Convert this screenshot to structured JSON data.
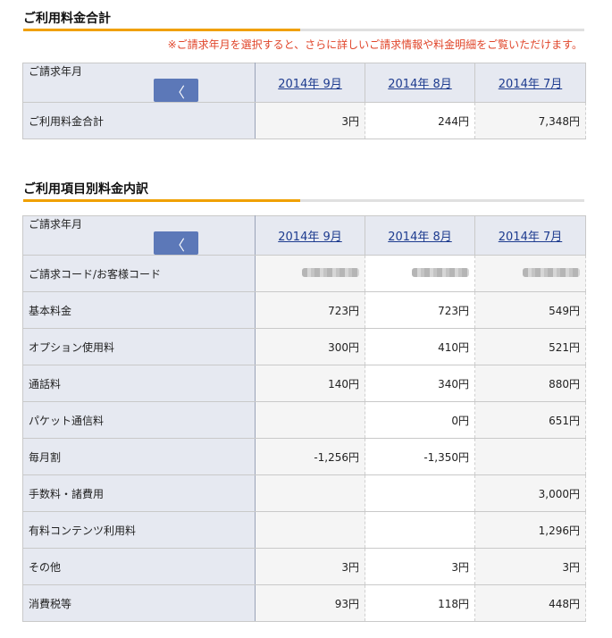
{
  "summary": {
    "title": "ご利用料金合計",
    "note": "※ご請求年月を選択すると、さらに詳しいご請求情報や料金明細をご覧いただけます。",
    "header_label": "ご請求年月",
    "prev_icon": "chevron-left-icon",
    "months": [
      "2014年 9月",
      "2014年 8月",
      "2014年 7月"
    ],
    "total_row": {
      "label": "ご利用料金合計",
      "values": [
        "3円",
        "244円",
        "7,348円"
      ]
    }
  },
  "breakdown": {
    "title": "ご利用項目別料金内訳",
    "header_label": "ご請求年月",
    "months": [
      "2014年 9月",
      "2014年 8月",
      "2014年 7月"
    ],
    "code_row_label": "ご請求コード/お客様コード",
    "rows": [
      {
        "label": "基本料金",
        "values": [
          "723円",
          "723円",
          "549円"
        ]
      },
      {
        "label": "オプション使用料",
        "values": [
          "300円",
          "410円",
          "521円"
        ]
      },
      {
        "label": "通話料",
        "values": [
          "140円",
          "340円",
          "880円"
        ]
      },
      {
        "label": "パケット通信料",
        "values": [
          "",
          "0円",
          "651円"
        ]
      },
      {
        "label": "毎月割",
        "values": [
          "-1,256円",
          "-1,350円",
          ""
        ]
      },
      {
        "label": "手数料・諸費用",
        "values": [
          "",
          "",
          "3,000円"
        ]
      },
      {
        "label": "有料コンテンツ利用料",
        "values": [
          "",
          "",
          "1,296円"
        ]
      },
      {
        "label": "その他",
        "values": [
          "3円",
          "3円",
          "3円"
        ]
      },
      {
        "label": "消費税等",
        "values": [
          "93円",
          "118円",
          "448円"
        ]
      }
    ]
  },
  "colors": {
    "accent": "#f0a000",
    "note": "#e0452a",
    "link": "#1d3b8f",
    "button": "#5c78b8",
    "label_bg": "#e6e9f1"
  }
}
